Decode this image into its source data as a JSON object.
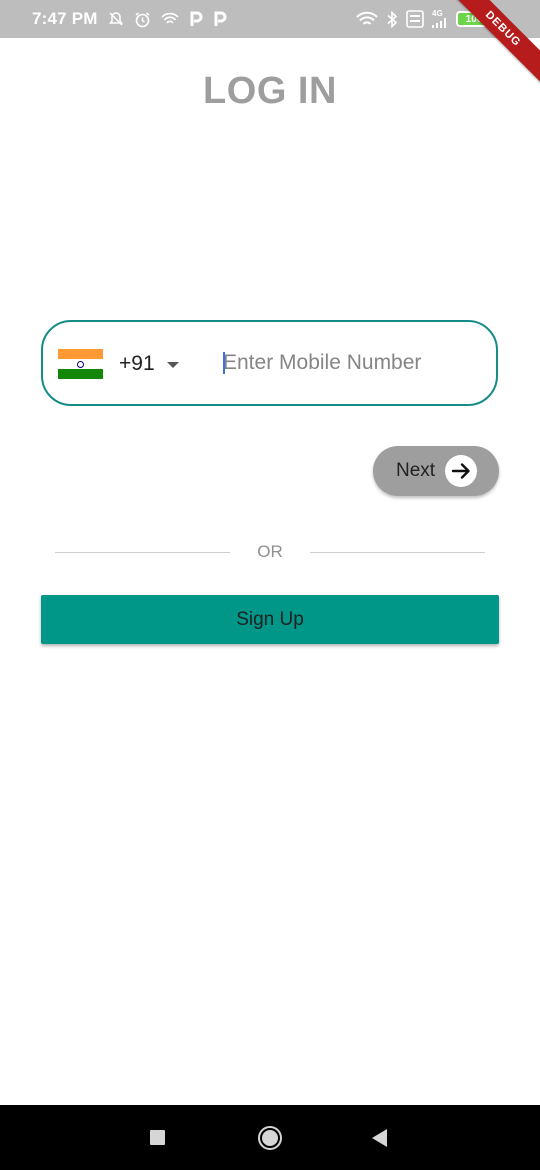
{
  "status_bar": {
    "time": "7:47 PM",
    "left_icons": [
      "bell-off-icon",
      "alarm-icon",
      "wifi-calling-icon",
      "p-app-icon",
      "p-app-icon"
    ],
    "right_icons": [
      "wifi-icon",
      "bluetooth-icon",
      "volte-icon",
      "signal-icon"
    ],
    "network_type": "4G",
    "battery_level": "100",
    "battery_color": "#6ed44a"
  },
  "debug_banner": "DEBUG",
  "login": {
    "title": "LOG IN",
    "country_code": "+91",
    "country_flag": "india-flag",
    "mobile_placeholder": "Enter Mobile Number",
    "mobile_value": "",
    "next_label": "Next",
    "or_label": "OR",
    "signup_label": "Sign Up"
  },
  "colors": {
    "accent": "#009688",
    "field_border": "#138d85",
    "title": "#9e9e9e",
    "next_button": "#9e9e9e"
  },
  "nav_bar": {
    "buttons": [
      "recents-icon",
      "home-icon",
      "back-icon"
    ]
  }
}
